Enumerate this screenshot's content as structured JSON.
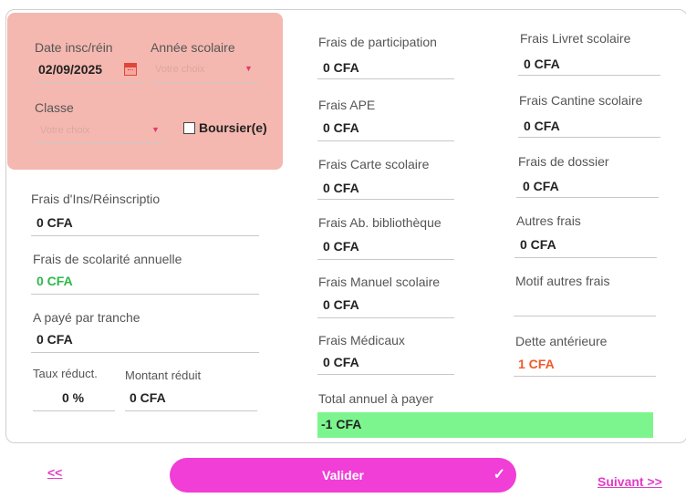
{
  "left_top": {
    "date_label": "Date insc/réin",
    "date_value": "02/09/2025",
    "year_label": "Année scolaire",
    "year_placeholder": "Votre choix",
    "class_label": "Classe",
    "class_placeholder": "Votre choix",
    "boursier_label": "Boursier(e)"
  },
  "left": {
    "ins_label": "Frais d'Ins/Réinscriptio",
    "ins_value": "0 CFA",
    "scol_label": "Frais de scolarité annuelle",
    "scol_value": "0 CFA",
    "tranche_label": "A payé par tranche",
    "tranche_value": "0 CFA",
    "taux_label": "Taux réduct.",
    "taux_value": "0 %",
    "montant_label": "Montant réduit",
    "montant_value": "0 CFA"
  },
  "middle": {
    "participation_label": "Frais de participation",
    "participation_value": "0 CFA",
    "ape_label": "Frais APE",
    "ape_value": "0 CFA",
    "carte_label": "Frais Carte scolaire",
    "carte_value": "0 CFA",
    "biblio_label": "Frais Ab. bibliothèque",
    "biblio_value": "0 CFA",
    "manuel_label": "Frais Manuel scolaire",
    "manuel_value": "0 CFA",
    "medicaux_label": "Frais Médicaux",
    "medicaux_value": "0 CFA",
    "total_label": "Total annuel à payer",
    "total_value": "-1 CFA"
  },
  "right": {
    "livret_label": "Frais Livret scolaire",
    "livret_value": "0 CFA",
    "cantine_label": "Frais Cantine scolaire",
    "cantine_value": "0 CFA",
    "dossier_label": "Frais de dossier",
    "dossier_value": "0 CFA",
    "autres_label": "Autres frais",
    "autres_value": "0 CFA",
    "motif_label": "Motif autres frais",
    "dette_label": "Dette antérieure",
    "dette_value": "1 CFA"
  },
  "footer": {
    "prev_label": "<<",
    "validate_label": "Valider",
    "next_label": "Suivant  >>"
  },
  "colors": {
    "pink_panel": "#f5b8b0",
    "accent": "#f03ed7",
    "total_bg": "#7df58e",
    "positive": "#2db84a",
    "debt": "#f05a28"
  }
}
